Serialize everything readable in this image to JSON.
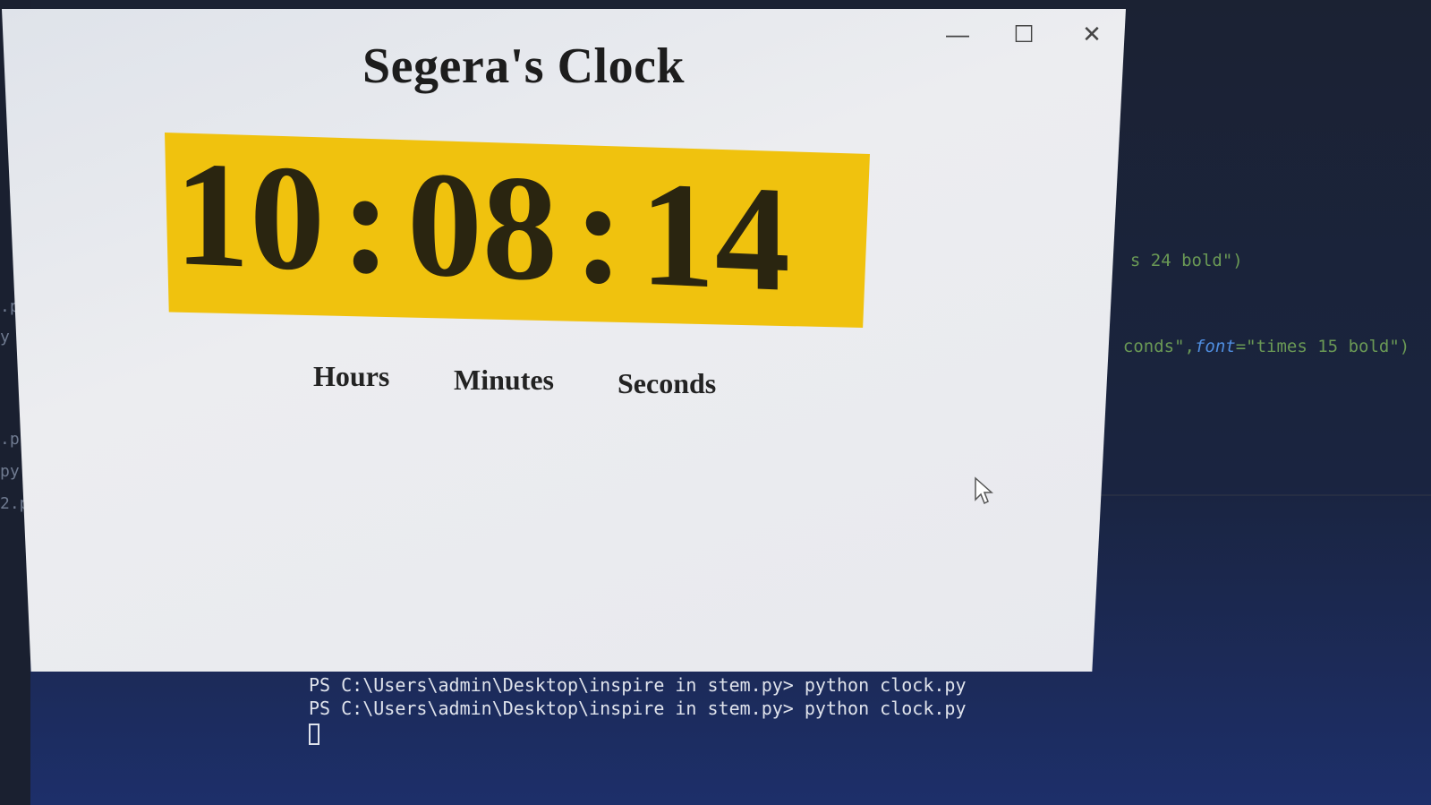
{
  "window": {
    "title": "Segera's Clock",
    "controls": {
      "minimize": "—",
      "maximize": "☐",
      "close": "✕"
    },
    "clock": {
      "hours": "10",
      "minutes": "08",
      "seconds": "14",
      "separator": ":"
    },
    "labels": {
      "hours": "Hours",
      "minutes": "Minutes",
      "seconds": "Seconds"
    },
    "colors": {
      "clock_bg": "#f0c20e",
      "clock_fg": "#2a2510"
    }
  },
  "editor": {
    "gutter": [
      ".p",
      "y",
      ".p",
      "py",
      "2.p"
    ],
    "code": [
      {
        "pre": "s 24 bold\")",
        "kw": "",
        "post": ""
      },
      {
        "pre": "conds\",",
        "kw": "font",
        "post": "=\"times 15 bold\")"
      }
    ]
  },
  "terminal": {
    "lines": [
      "PS C:\\Users\\admin\\Desktop\\inspire in stem.py> python clock.py",
      "PS C:\\Users\\admin\\Desktop\\inspire in stem.py> python clock.py"
    ]
  }
}
